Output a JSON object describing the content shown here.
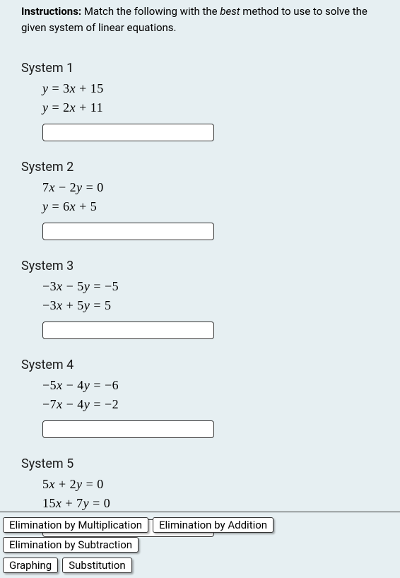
{
  "instructions": {
    "label": "Instructions:",
    "prefix": " Match the following with the ",
    "italic": "best",
    "suffix": " method to use to solve the given system of linear equations."
  },
  "systems": [
    {
      "title": "System 1",
      "eq1": "y = 3x + 15",
      "eq2": "y = 2x + 11"
    },
    {
      "title": "System 2",
      "eq1": "7x − 2y = 0",
      "eq2": "y = 6x + 5"
    },
    {
      "title": "System 3",
      "eq1": "−3x − 5y = −5",
      "eq2": "−3x + 5y = 5"
    },
    {
      "title": "System 4",
      "eq1": "−5x − 4y = −6",
      "eq2": "−7x − 4y = −2"
    },
    {
      "title": "System 5",
      "eq1": "5x + 2y = 0",
      "eq2": "15x + 7y = 0"
    }
  ],
  "choices": [
    "Elimination by Multiplication",
    "Elimination by Addition",
    "Elimination by Subtraction",
    "Graphing",
    "Substitution"
  ]
}
